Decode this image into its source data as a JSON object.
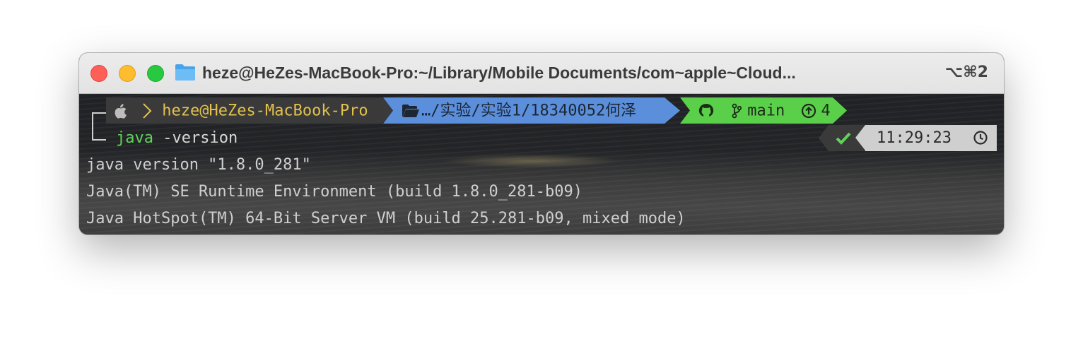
{
  "window": {
    "title": "heze@HeZes-MacBook-Pro:~/Library/Mobile Documents/com~apple~Cloud...",
    "shortcut": "⌥⌘2"
  },
  "prompt": {
    "user_host": "heze@HeZes-MacBook-Pro",
    "path": "…/实验/实验1/18340052何泽",
    "branch": "main",
    "ahead_count": "4"
  },
  "command": {
    "name": "java",
    "args": "-version"
  },
  "status": {
    "time": "11:29:23"
  },
  "output": [
    "java version \"1.8.0_281\"",
    "Java(TM) SE Runtime Environment (build 1.8.0_281-b09)",
    "Java HotSpot(TM) 64-Bit Server VM (build 25.281-b09, mixed mode)"
  ],
  "colors": {
    "user_segment_bg": "#3a3a3a",
    "user_text": "#e2c14e",
    "path_segment_bg": "#5b8fdc",
    "git_segment_bg": "#5ad04a",
    "command_color": "#5fd35a",
    "status_ok": "#5fd35a"
  },
  "icons": {
    "os": "apple-icon",
    "prompt": "chevron-right-icon",
    "folder": "folder-open-icon",
    "git_host": "github-icon",
    "branch": "git-branch-icon",
    "ahead": "arrow-up-circle-icon",
    "status": "check-icon",
    "clock": "clock-icon"
  }
}
